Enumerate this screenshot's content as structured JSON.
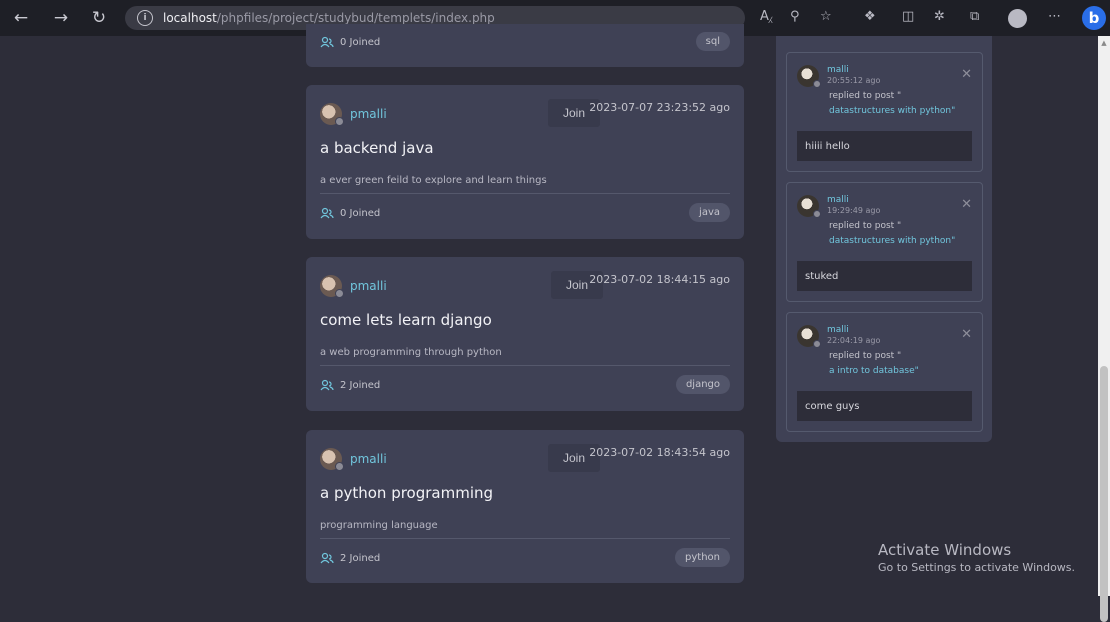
{
  "browser": {
    "url_host": "localhost",
    "url_path": "/phpfiles/project/studybud/templets/index.php"
  },
  "rooms": [
    {
      "host": "",
      "join_label": "",
      "date": "",
      "title": "",
      "description": "",
      "joined": "0 Joined",
      "tag": "sql"
    },
    {
      "host": "pmalli",
      "join_label": "Join",
      "date": "2023-07-07 23:23:52 ago",
      "title": "a backend java",
      "description": "a ever green feild to explore and learn things",
      "joined": "0 Joined",
      "tag": "java"
    },
    {
      "host": "pmalli",
      "join_label": "Join",
      "date": "2023-07-02 18:44:15 ago",
      "title": "come lets learn django",
      "description": "a web programming through python",
      "joined": "2 Joined",
      "tag": "django"
    },
    {
      "host": "pmalli",
      "join_label": "Join",
      "date": "2023-07-02 18:43:54 ago",
      "title": "a python programming",
      "description": "programming language",
      "joined": "2 Joined",
      "tag": "python"
    }
  ],
  "activities": [
    {
      "user": "malli",
      "time": "20:55:12 ago",
      "action": "replied to post \"",
      "post": "datastructures with python\"",
      "message": "hiiii hello"
    },
    {
      "user": "malli",
      "time": "19:29:49 ago",
      "action": "replied to post \"",
      "post": "datastructures with python\"",
      "message": "stuked"
    },
    {
      "user": "malli",
      "time": "22:04:19 ago",
      "action": "replied to post \"",
      "post": "a intro to database\"",
      "message": "come guys"
    }
  ],
  "watermark": {
    "title": "Activate Windows",
    "subtitle": "Go to Settings to activate Windows."
  },
  "colors": {
    "accent": "#71c6dd",
    "card": "#3f4155",
    "background": "#2d2d39"
  }
}
